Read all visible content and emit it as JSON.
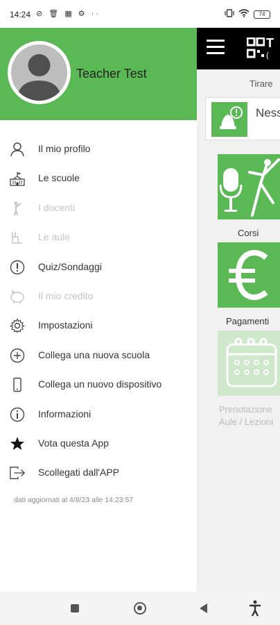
{
  "status_bar": {
    "time": "14:24",
    "left_icons": [
      "vpn-off-icon",
      "trash-icon",
      "sim-icon",
      "settings-icon",
      "more-dots-icon"
    ],
    "right_icons": [
      "vibrate-icon",
      "wifi-icon",
      "battery-icon"
    ],
    "battery_level": "74"
  },
  "drawer": {
    "user_name": "Teacher Test",
    "header_color": "#5bb955",
    "items": [
      {
        "label": "Il mio profilo",
        "icon": "person-icon",
        "enabled": true
      },
      {
        "label": "Le scuole",
        "icon": "school-building-icon",
        "enabled": true
      },
      {
        "label": "I docenti",
        "icon": "teacher-icon",
        "enabled": false
      },
      {
        "label": "Le aule",
        "icon": "classroom-icon",
        "enabled": false
      },
      {
        "label": "Quiz/Sondaggi",
        "icon": "quiz-icon",
        "enabled": true
      },
      {
        "label": "Il mio credito",
        "icon": "piggy-bank-icon",
        "enabled": false
      },
      {
        "label": "Impostazioni",
        "icon": "gear-icon",
        "enabled": true
      },
      {
        "label": "Collega una nuova scuola",
        "icon": "plus-circle-icon",
        "enabled": true
      },
      {
        "label": "Collega un nuovo dispositivo",
        "icon": "phone-icon",
        "enabled": true
      },
      {
        "label": "Informazioni",
        "icon": "info-icon",
        "enabled": true
      },
      {
        "label": "Vota questa App",
        "icon": "star-icon",
        "enabled": true
      },
      {
        "label": "Scollegati dall'APP",
        "icon": "logout-icon",
        "enabled": true
      }
    ],
    "updated_text": "dati aggiornati al 4/8/23 alle 14:23:57"
  },
  "background": {
    "topbar_title": "T",
    "topbar_subtitle": "(",
    "pull_text": "Tirare",
    "notification_text": "Ness",
    "tiles": [
      {
        "label": "Corsi",
        "icon": "microphone-dancer-icon",
        "enabled": true
      },
      {
        "label": "Pagamenti",
        "icon": "euro-icon",
        "enabled": true
      },
      {
        "label": "Prenotazione\nAule / Lezioni",
        "icon": "calendar-icon",
        "enabled": false
      }
    ],
    "tile_label_3_line1": "Prenotazione",
    "tile_label_3_line2": "Aule / Lezioni"
  },
  "nav_bar": {
    "buttons": [
      "recents-button",
      "home-button",
      "back-button",
      "accessibility-button"
    ]
  }
}
